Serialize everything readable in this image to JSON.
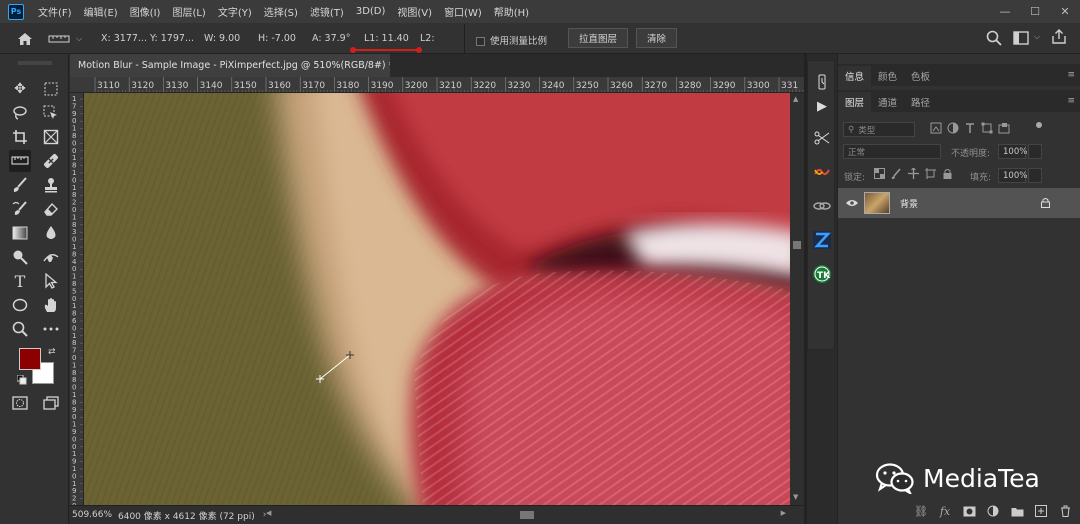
{
  "menu": {
    "items": [
      "文件(F)",
      "编辑(E)",
      "图像(I)",
      "图层(L)",
      "文字(Y)",
      "选择(S)",
      "滤镜(T)",
      "3D(D)",
      "视图(V)",
      "窗口(W)",
      "帮助(H)"
    ],
    "logo": "Ps"
  },
  "options": {
    "x": "X: 3177...",
    "y": "Y: 1797...",
    "w": "W: 9.00",
    "h": "H: -7.00",
    "a": "A: 37.9°",
    "l1": "L1: 11.40",
    "l2": "L2:",
    "use_scale": "使用测量比例",
    "straighten_btn": "拉直图层",
    "clear_btn": "清除",
    "highlight_color": "#d0201a"
  },
  "document": {
    "tab_title": "Motion Blur - Sample Image - PiXimperfect.jpg @ 510%(RGB/8#) *",
    "close": "×",
    "ruler_top": [
      "3110",
      "3120",
      "3130",
      "3140",
      "3150",
      "3160",
      "3170",
      "3180",
      "3190",
      "3200",
      "3210",
      "3220",
      "3230",
      "3240",
      "3250",
      "3260",
      "3270",
      "3280",
      "3290",
      "3300",
      "331"
    ],
    "ruler_left": [
      "1",
      "7",
      "9",
      "0",
      "1",
      "8",
      "0",
      "0",
      "1",
      "8",
      "1",
      "0",
      "1",
      "8",
      "2",
      "0",
      "1",
      "8",
      "3",
      "0",
      "1",
      "8",
      "4",
      "0",
      "1",
      "8",
      "5",
      "0",
      "1",
      "8",
      "6",
      "0",
      "1",
      "8",
      "7",
      "0",
      "1",
      "8",
      "8",
      "0",
      "1",
      "8",
      "9",
      "0",
      "1",
      "9",
      "0",
      "0",
      "1",
      "9",
      "1",
      "0",
      "1",
      "9",
      "2",
      "0"
    ]
  },
  "status": {
    "zoom": "509.66%",
    "size": "6400 像素 x 4612 像素 (72 ppi)",
    "arrow": "›"
  },
  "panels": {
    "top_tabs": [
      "信息",
      "颜色",
      "色板"
    ],
    "layer_tabs": [
      "图层",
      "通道",
      "路径"
    ],
    "kind_placeholder": "类型",
    "blend_mode": "正常",
    "opacity_label": "不透明度:",
    "opacity_value": "100%",
    "lock_label": "锁定:",
    "fill_label": "填充:",
    "fill_value": "100%",
    "layer_name": "背景"
  },
  "colors": {
    "foreground": "#8b0000",
    "background": "#ffffff",
    "accent_blue": "#31a8ff"
  },
  "watermark": {
    "text": "MediaTea"
  }
}
